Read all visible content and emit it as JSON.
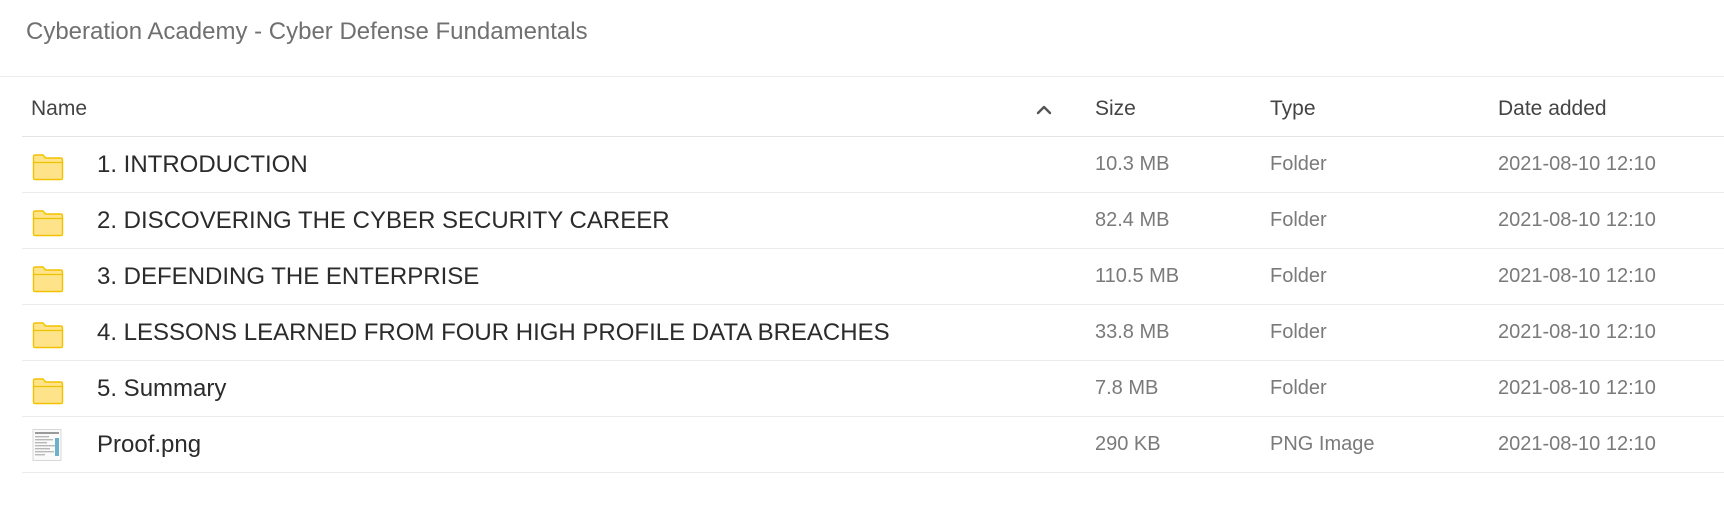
{
  "window": {
    "title": "Cyberation Academy - Cyber Defense Fundamentals"
  },
  "table": {
    "columns": {
      "name": "Name",
      "size": "Size",
      "type": "Type",
      "date": "Date added"
    },
    "sort": {
      "column": "name",
      "direction": "ascending",
      "icon": "chevron-up-icon"
    },
    "rows": [
      {
        "icon": "folder-icon",
        "name": "1. INTRODUCTION",
        "size": "10.3 MB",
        "type": "Folder",
        "date": "2021-08-10 12:10"
      },
      {
        "icon": "folder-icon",
        "name": "2. DISCOVERING THE CYBER SECURITY CAREER",
        "size": "82.4 MB",
        "type": "Folder",
        "date": "2021-08-10 12:10"
      },
      {
        "icon": "folder-icon",
        "name": "3. DEFENDING THE ENTERPRISE",
        "size": "110.5 MB",
        "type": "Folder",
        "date": "2021-08-10 12:10"
      },
      {
        "icon": "folder-icon",
        "name": "4. LESSONS LEARNED FROM FOUR HIGH PROFILE DATA BREACHES",
        "size": "33.8 MB",
        "type": "Folder",
        "date": "2021-08-10 12:10"
      },
      {
        "icon": "folder-icon",
        "name": "5. Summary",
        "size": "7.8 MB",
        "type": "Folder",
        "date": "2021-08-10 12:10"
      },
      {
        "icon": "image-thumbnail-icon",
        "name": "Proof.png",
        "size": "290 KB",
        "type": "PNG Image",
        "date": "2021-08-10 12:10"
      }
    ]
  },
  "colors": {
    "folder_fill": "#ffe38a",
    "folder_stroke": "#f2c200"
  }
}
